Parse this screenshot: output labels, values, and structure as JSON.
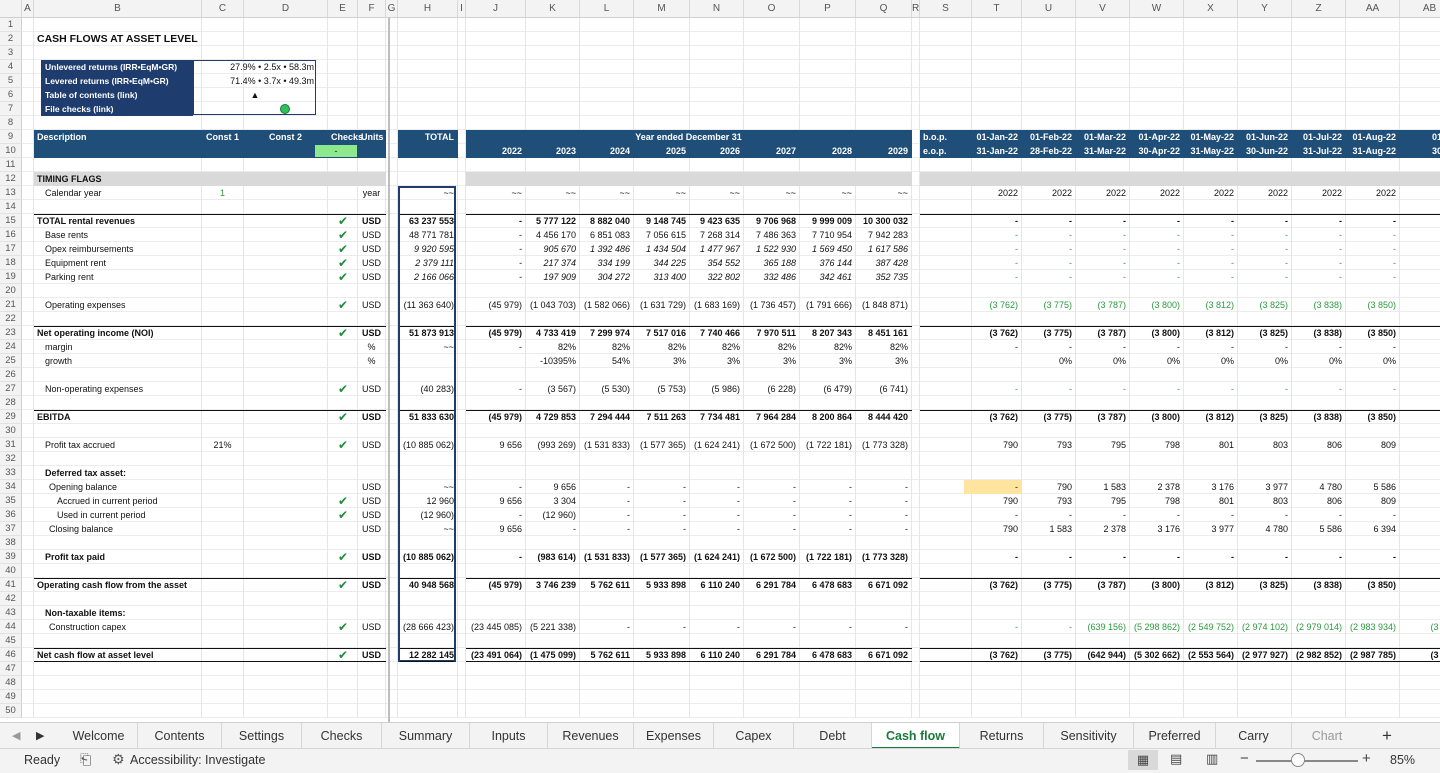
{
  "columns": [
    "A",
    "B",
    "C",
    "D",
    "E",
    "F",
    "G",
    "H",
    "I",
    "J",
    "K",
    "L",
    "M",
    "N",
    "O",
    "P",
    "Q",
    "R",
    "S",
    "T",
    "U",
    "V",
    "W",
    "X",
    "Y",
    "Z",
    "AA",
    "AB"
  ],
  "rows": [
    "1",
    "2",
    "3",
    "4",
    "5",
    "6",
    "7",
    "8",
    "9",
    "10",
    "11",
    "12",
    "13",
    "14",
    "15",
    "16",
    "17",
    "18",
    "19",
    "20",
    "21",
    "22",
    "23",
    "24",
    "25",
    "26",
    "27",
    "28",
    "29",
    "30",
    "31",
    "32",
    "33",
    "34",
    "35",
    "36",
    "37",
    "38",
    "39",
    "40",
    "41",
    "42",
    "43",
    "44",
    "45",
    "46",
    "47",
    "48",
    "49",
    "50"
  ],
  "title": "CASH FLOWS AT ASSET LEVEL",
  "summary": [
    {
      "label": "Unlevered returns (IRR•EqM•GR)",
      "value": "27.9% • 2.5x • 58.3m"
    },
    {
      "label": "Levered returns (IRR•EqM•GR)",
      "value": "71.4% • 3.7x • 49.3m"
    },
    {
      "label": "Table of contents (link)",
      "value": "▲"
    },
    {
      "label": "File checks (link)",
      "value": ""
    }
  ],
  "header": {
    "description": "Description",
    "const1": "Const 1",
    "const2": "Const 2",
    "checks": "Checks",
    "units": "Units",
    "total": "TOTAL",
    "checks_value": "-",
    "year_title": "Year ended December 31",
    "years": [
      "2022",
      "2023",
      "2024",
      "2025",
      "2026",
      "2027",
      "2028",
      "2029"
    ],
    "bop": "b.o.p.",
    "eop": "e.o.p.",
    "month_starts": [
      "01-Jan-22",
      "01-Feb-22",
      "01-Mar-22",
      "01-Apr-22",
      "01-May-22",
      "01-Jun-22",
      "01-Jul-22",
      "01-Aug-22",
      "01-Se"
    ],
    "month_ends": [
      "31-Jan-22",
      "28-Feb-22",
      "31-Mar-22",
      "30-Apr-22",
      "31-May-22",
      "30-Jun-22",
      "31-Jul-22",
      "31-Aug-22",
      "30-Se"
    ]
  },
  "section_timing": "TIMING FLAGS",
  "lines": [
    {
      "row": 13,
      "label": "Calendar year",
      "indent": 1,
      "c": "1",
      "unit": "year",
      "total": "~~",
      "annual": [
        "~~",
        "~~",
        "~~",
        "~~",
        "~~",
        "~~",
        "~~",
        "~~"
      ],
      "monthly": [
        "2022",
        "2022",
        "2022",
        "2022",
        "2022",
        "2022",
        "2022",
        "2022",
        ""
      ]
    },
    {
      "row": 15,
      "label": "TOTAL rental revenues",
      "indent": 0,
      "bold": true,
      "check": true,
      "unit": "USD",
      "total": "63 237 553",
      "annual": [
        "-",
        "5 777 122",
        "8 882 040",
        "9 148 745",
        "9 423 635",
        "9 706 968",
        "9 999 009",
        "10 300 032"
      ],
      "monthly": [
        "-",
        "-",
        "-",
        "-",
        "-",
        "-",
        "-",
        "-",
        ""
      ]
    },
    {
      "row": 16,
      "label": "Base rents",
      "indent": 1,
      "check": true,
      "unit": "USD",
      "total": "48 771 781",
      "annual": [
        "-",
        "4 456 170",
        "6 851 083",
        "7 056 615",
        "7 268 314",
        "7 486 363",
        "7 710 954",
        "7 942 283"
      ],
      "monthly": [
        "-",
        "-",
        "-",
        "-",
        "-",
        "-",
        "-",
        "-",
        ""
      ],
      "mgreen": true
    },
    {
      "row": 17,
      "label": "Opex reimbursements",
      "indent": 1,
      "check": true,
      "unit": "USD",
      "total": "9 920 595",
      "italic": true,
      "annual": [
        "-",
        "905 670",
        "1 392 486",
        "1 434 504",
        "1 477 967",
        "1 522 930",
        "1 569 450",
        "1 617 586"
      ],
      "monthly": [
        "-",
        "-",
        "-",
        "-",
        "-",
        "-",
        "-",
        "-",
        ""
      ],
      "mgreen": true
    },
    {
      "row": 18,
      "label": "Equipment rent",
      "indent": 1,
      "check": true,
      "unit": "USD",
      "total": "2 379 111",
      "italic": true,
      "annual": [
        "-",
        "217 374",
        "334 199",
        "344 225",
        "354 552",
        "365 188",
        "376 144",
        "387 428"
      ],
      "monthly": [
        "-",
        "-",
        "-",
        "-",
        "-",
        "-",
        "-",
        "-",
        ""
      ],
      "mgreen": true
    },
    {
      "row": 19,
      "label": "Parking rent",
      "indent": 1,
      "check": true,
      "unit": "USD",
      "total": "2 166 066",
      "italic": true,
      "annual": [
        "-",
        "197 909",
        "304 272",
        "313 400",
        "322 802",
        "332 486",
        "342 461",
        "352 735"
      ],
      "monthly": [
        "-",
        "-",
        "-",
        "-",
        "-",
        "-",
        "-",
        "-",
        ""
      ],
      "mgreen": true
    },
    {
      "row": 21,
      "label": "Operating expenses",
      "indent": 1,
      "check": true,
      "unit": "USD",
      "total": "(11 363 640)",
      "annual": [
        "(45 979)",
        "(1 043 703)",
        "(1 582 066)",
        "(1 631 729)",
        "(1 683 169)",
        "(1 736 457)",
        "(1 791 666)",
        "(1 848 871)"
      ],
      "monthly": [
        "(3 762)",
        "(3 775)",
        "(3 787)",
        "(3 800)",
        "(3 812)",
        "(3 825)",
        "(3 838)",
        "(3 850)",
        "(3"
      ],
      "mgreen": true
    },
    {
      "row": 23,
      "label": "Net operating income (NOI)",
      "indent": 0,
      "bold": true,
      "check": true,
      "unit": "USD",
      "total": "51 873 913",
      "annual": [
        "(45 979)",
        "4 733 419",
        "7 299 974",
        "7 517 016",
        "7 740 466",
        "7 970 511",
        "8 207 343",
        "8 451 161"
      ],
      "monthly": [
        "(3 762)",
        "(3 775)",
        "(3 787)",
        "(3 800)",
        "(3 812)",
        "(3 825)",
        "(3 838)",
        "(3 850)",
        "(3"
      ]
    },
    {
      "row": 24,
      "label": "margin",
      "indent": 1,
      "unit": "%",
      "total": "~~",
      "annual": [
        "-",
        "82%",
        "82%",
        "82%",
        "82%",
        "82%",
        "82%",
        "82%"
      ],
      "monthly": [
        "-",
        "-",
        "-",
        "-",
        "-",
        "-",
        "-",
        "-",
        ""
      ]
    },
    {
      "row": 25,
      "label": "growth",
      "indent": 1,
      "unit": "%",
      "total": "",
      "annual": [
        "",
        "-10395%",
        "54%",
        "3%",
        "3%",
        "3%",
        "3%",
        "3%"
      ],
      "monthly": [
        "",
        "0%",
        "0%",
        "0%",
        "0%",
        "0%",
        "0%",
        "0%",
        ""
      ]
    },
    {
      "row": 27,
      "label": "Non-operating expenses",
      "indent": 1,
      "check": true,
      "unit": "USD",
      "total": "(40 283)",
      "annual": [
        "-",
        "(3 567)",
        "(5 530)",
        "(5 753)",
        "(5 986)",
        "(6 228)",
        "(6 479)",
        "(6 741)"
      ],
      "monthly": [
        "-",
        "-",
        "-",
        "-",
        "-",
        "-",
        "-",
        "-",
        ""
      ],
      "mgreen": true
    },
    {
      "row": 29,
      "label": "EBITDA",
      "indent": 0,
      "bold": true,
      "check": true,
      "unit": "USD",
      "total": "51 833 630",
      "annual": [
        "(45 979)",
        "4 729 853",
        "7 294 444",
        "7 511 263",
        "7 734 481",
        "7 964 284",
        "8 200 864",
        "8 444 420"
      ],
      "monthly": [
        "(3 762)",
        "(3 775)",
        "(3 787)",
        "(3 800)",
        "(3 812)",
        "(3 825)",
        "(3 838)",
        "(3 850)",
        "(3"
      ]
    },
    {
      "row": 31,
      "label": "Profit tax accrued",
      "indent": 1,
      "c": "21%",
      "check": true,
      "unit": "USD",
      "total": "(10 885 062)",
      "annual": [
        "9 656",
        "(993 269)",
        "(1 531 833)",
        "(1 577 365)",
        "(1 624 241)",
        "(1 672 500)",
        "(1 722 181)",
        "(1 773 328)"
      ],
      "monthly": [
        "790",
        "793",
        "795",
        "798",
        "801",
        "803",
        "806",
        "809",
        ""
      ]
    },
    {
      "row": 33,
      "label": "Deferred tax asset:",
      "indent": 1,
      "bold": true,
      "unit": "",
      "total": "",
      "annual": [
        "",
        "",
        "",
        "",
        "",
        "",
        "",
        ""
      ],
      "monthly": [
        "",
        "",
        "",
        "",
        "",
        "",
        "",
        "",
        ""
      ]
    },
    {
      "row": 34,
      "label": "Opening balance",
      "indent": 2,
      "unit": "USD",
      "total": "~~",
      "annual": [
        "-",
        "9 656",
        "-",
        "-",
        "-",
        "-",
        "-",
        "-"
      ],
      "monthly": [
        "-",
        "790",
        "1 583",
        "2 378",
        "3 176",
        "3 977",
        "4 780",
        "5 586",
        "6"
      ]
    },
    {
      "row": 35,
      "label": "Accrued in current period",
      "indent": 3,
      "check": true,
      "unit": "USD",
      "total": "12 960",
      "annual": [
        "9 656",
        "3 304",
        "-",
        "-",
        "-",
        "-",
        "-",
        "-"
      ],
      "monthly": [
        "790",
        "793",
        "795",
        "798",
        "801",
        "803",
        "806",
        "809",
        ""
      ]
    },
    {
      "row": 36,
      "label": "Used in current period",
      "indent": 3,
      "check": true,
      "unit": "USD",
      "total": "(12 960)",
      "annual": [
        "-",
        "(12 960)",
        "-",
        "-",
        "-",
        "-",
        "-",
        "-"
      ],
      "monthly": [
        "-",
        "-",
        "-",
        "-",
        "-",
        "-",
        "-",
        "-",
        ""
      ]
    },
    {
      "row": 37,
      "label": "Closing balance",
      "indent": 2,
      "unit": "USD",
      "total": "~~",
      "annual": [
        "9 656",
        "-",
        "-",
        "-",
        "-",
        "-",
        "-",
        "-"
      ],
      "monthly": [
        "790",
        "1 583",
        "2 378",
        "3 176",
        "3 977",
        "4 780",
        "5 586",
        "6 394",
        "7"
      ]
    },
    {
      "row": 39,
      "label": "Profit tax paid",
      "indent": 1,
      "bold": true,
      "check": true,
      "unit": "USD",
      "total": "(10 885 062)",
      "annual": [
        "-",
        "(983 614)",
        "(1 531 833)",
        "(1 577 365)",
        "(1 624 241)",
        "(1 672 500)",
        "(1 722 181)",
        "(1 773 328)"
      ],
      "monthly": [
        "-",
        "-",
        "-",
        "-",
        "-",
        "-",
        "-",
        "-",
        ""
      ]
    },
    {
      "row": 41,
      "label": "Operating cash flow from the asset",
      "indent": 0,
      "bold": true,
      "check": true,
      "unit": "USD",
      "total": "40 948 568",
      "annual": [
        "(45 979)",
        "3 746 239",
        "5 762 611",
        "5 933 898",
        "6 110 240",
        "6 291 784",
        "6 478 683",
        "6 671 092"
      ],
      "monthly": [
        "(3 762)",
        "(3 775)",
        "(3 787)",
        "(3 800)",
        "(3 812)",
        "(3 825)",
        "(3 838)",
        "(3 850)",
        "(3"
      ]
    },
    {
      "row": 43,
      "label": "Non-taxable items:",
      "indent": 1,
      "bold": true,
      "unit": "",
      "total": "",
      "annual": [
        "",
        "",
        "",
        "",
        "",
        "",
        "",
        ""
      ],
      "monthly": [
        "",
        "",
        "",
        "",
        "",
        "",
        "",
        "",
        ""
      ]
    },
    {
      "row": 44,
      "label": "Construction capex",
      "indent": 2,
      "check": true,
      "unit": "USD",
      "total": "(28 666 423)",
      "annual": [
        "(23 445 085)",
        "(5 221 338)",
        "-",
        "-",
        "-",
        "-",
        "-",
        "-"
      ],
      "monthly": [
        "-",
        "-",
        "(639 156)",
        "(5 298 862)",
        "(2 549 752)",
        "(2 974 102)",
        "(2 979 014)",
        "(2 983 934)",
        "(3 587"
      ],
      "mgreen": true
    },
    {
      "row": 46,
      "label": "Net cash flow at asset level",
      "indent": 0,
      "bold": true,
      "check": true,
      "unit": "USD",
      "total": "12 282 145",
      "annual": [
        "(23 491 064)",
        "(1 475 099)",
        "5 762 611",
        "5 933 898",
        "6 110 240",
        "6 291 784",
        "6 478 683",
        "6 671 092"
      ],
      "monthly": [
        "(3 762)",
        "(3 775)",
        "(642 944)",
        "(5 302 662)",
        "(2 553 564)",
        "(2 977 927)",
        "(2 982 852)",
        "(2 987 785)",
        "(3 590"
      ]
    }
  ],
  "tabs": [
    "Welcome",
    "Contents",
    "Settings",
    "Checks",
    "Summary",
    "Inputs",
    "Revenues",
    "Expenses",
    "Capex",
    "Debt",
    "Cash flow",
    "Returns",
    "Sensitivity",
    "Preferred",
    "Carry",
    "Chart"
  ],
  "active_tab": "Cash flow",
  "status": {
    "ready": "Ready",
    "accessibility": "Accessibility: Investigate",
    "zoom": "85%"
  },
  "colors": {
    "navy": "#1f3c6e",
    "header_fill": "#1f4e79",
    "green": "#2a9a3c",
    "highlight": "#ffe4a0",
    "check_fill": "#8ee88e"
  }
}
